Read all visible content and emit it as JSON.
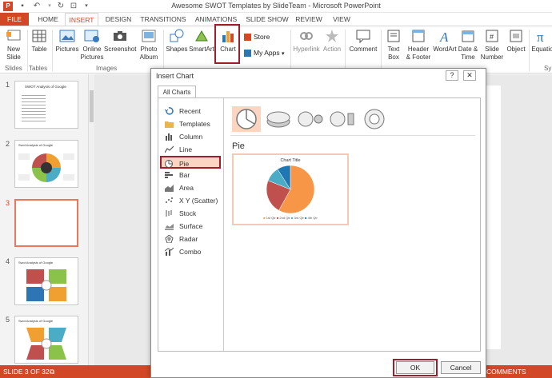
{
  "window": {
    "title": "Awesome SWOT Templates by SlideTeam - Microsoft PowerPoint"
  },
  "tabs": [
    "FILE",
    "HOME",
    "INSERT",
    "DESIGN",
    "TRANSITIONS",
    "ANIMATIONS",
    "SLIDE SHOW",
    "REVIEW",
    "VIEW"
  ],
  "ribbon": {
    "new_slide": "New",
    "new_slide2": "Slide",
    "table": "Table",
    "pictures": "Pictures",
    "online_pictures": "Online",
    "online_pictures2": "Pictures",
    "screenshot": "Screenshot",
    "photo_album": "Photo",
    "photo_album2": "Album",
    "shapes": "Shapes",
    "smartart": "SmartArt",
    "chart": "Chart",
    "store": "Store",
    "my_apps": "My Apps",
    "hyperlink": "Hyperlink",
    "action": "Action",
    "comment": "Comment",
    "text_box": "Text",
    "text_box2": "Box",
    "header_footer": "Header",
    "header_footer2": "& Footer",
    "wordart": "WordArt",
    "date_time": "Date &",
    "date_time2": "Time",
    "slide_number": "Slide",
    "slide_number2": "Number",
    "object": "Object",
    "equation": "Equatio",
    "group_slides": "Slides",
    "group_tables": "Tables",
    "group_images": "Images",
    "group_sym": "Sy"
  },
  "slides": {
    "numbers": [
      "1",
      "2",
      "3",
      "4",
      "5"
    ],
    "thumb1_title": "SWOT Analysis of Google",
    "thumb2_title": "Swot Analysis of Google",
    "thumb4_title": "Swot Analysis of Google",
    "thumb5_title": "Swot Analysis of Google"
  },
  "status": {
    "slide_of": "SLIDE 3 OF 32",
    "comments": "COMMENTS"
  },
  "dialog": {
    "title": "Insert Chart",
    "help": "?",
    "close": "✕",
    "tab": "All Charts",
    "categories": [
      "Recent",
      "Templates",
      "Column",
      "Line",
      "Pie",
      "Bar",
      "Area",
      "X Y (Scatter)",
      "Stock",
      "Surface",
      "Radar",
      "Combo"
    ],
    "selected_category": "Pie",
    "section_title": "Pie",
    "preview_title": "Chart Title",
    "legend": [
      "1st Qtr",
      "2nd Qtr",
      "3rd Qtr",
      "4th Qtr"
    ],
    "ok": "OK",
    "cancel": "Cancel"
  },
  "chart_data": {
    "type": "pie",
    "title": "Chart Title",
    "categories": [
      "1st Qtr",
      "2nd Qtr",
      "3rd Qtr",
      "4th Qtr"
    ],
    "values": [
      58,
      23,
      10,
      9
    ],
    "colors": [
      "#f79646",
      "#c0504d",
      "#4bacc6",
      "#1f77b4"
    ]
  },
  "colors": {
    "accent": "#d24726",
    "highlight": "#a01e2b",
    "selected_fill": "#fbd5c2"
  }
}
